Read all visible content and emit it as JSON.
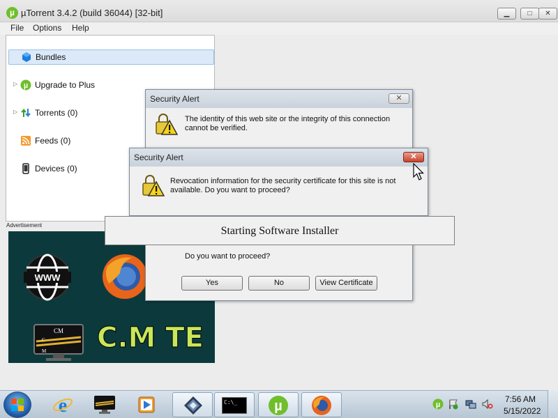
{
  "window": {
    "title": "µTorrent 3.4.2  (build 36044) [32-bit]",
    "app_icon_glyph": "µ",
    "minimize_glyph": "▁",
    "maximize_glyph": "□",
    "close_glyph": "✕"
  },
  "menu": [
    "File",
    "Options",
    "Help"
  ],
  "sidebar": {
    "items": [
      {
        "label": "Bundles",
        "icon": "bundles-icon",
        "selected": true
      },
      {
        "label": "Upgrade to Plus",
        "icon": "utorrent-plus-icon"
      },
      {
        "label": "Torrents (0)",
        "icon": "torrents-icon"
      },
      {
        "label": "Feeds (0)",
        "icon": "rss-icon"
      },
      {
        "label": "Devices (0)",
        "icon": "device-icon"
      }
    ]
  },
  "ad": {
    "label": "Advertisement",
    "logo_text": "WWW",
    "brand_text": "C.M TE",
    "monitor_text": "CM",
    "monitor_letters": [
      "C",
      "M"
    ]
  },
  "dialog_back": {
    "title": "Security Alert",
    "message": "The identity of this web site or the integrity of this connection cannot be verified.",
    "question": "Do you want to proceed?",
    "buttons": [
      "Yes",
      "No",
      "View Certificate"
    ]
  },
  "dialog_front": {
    "title": "Security Alert",
    "message": "Revocation information for the security certificate for this site is not available. Do you want to proceed?"
  },
  "installer": {
    "text": "Starting Software Installer"
  },
  "taskbar": {
    "apps": [
      "internet-explorer",
      "cm-tech",
      "media-player",
      "app-launcher",
      "command-prompt",
      "utorrent",
      "firefox"
    ],
    "cmd_text": "C:\\_",
    "clock_time": "7:56 AM",
    "clock_date": "5/15/2022"
  },
  "colors": {
    "utorrent_green": "#6fbf2b",
    "dialog_bg": "#f0f0f0",
    "ad_bg": "#0c3a3c",
    "ad_brand": "#c9e65a"
  }
}
